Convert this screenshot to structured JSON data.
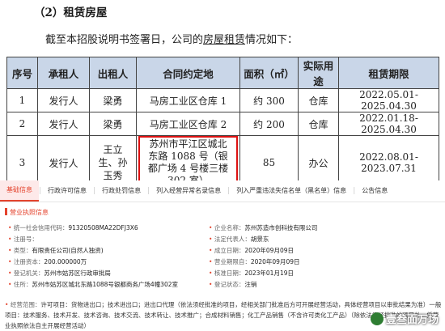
{
  "heading": "（2）租赁房屋",
  "intro": {
    "pre": "截至本招股说明书签署日，公司的",
    "ul": "房屋租赁",
    "post": "情况如下："
  },
  "table": {
    "headers": [
      "序号",
      "承租人",
      "出租人",
      "合同约定地",
      "面积（㎡）",
      "实际用途",
      "租赁期限"
    ],
    "rows": [
      [
        "1",
        "发行人",
        "梁勇",
        "马房工业区仓库 1",
        "约 300",
        "仓库",
        "2022.05.01-2025.04.30"
      ],
      [
        "2",
        "发行人",
        "梁勇",
        "马房工业区仓库 2",
        "约 200",
        "仓库",
        "2022.01.18-2025.04.30"
      ],
      [
        "3",
        "发行人",
        "王立生、孙玉秀",
        "苏州市平江区城北东路 1088 号（银都广场 4 号楼三楼 302 室）",
        "85",
        "办公",
        "2022.08.01-2023.07.31"
      ]
    ]
  },
  "tabs": [
    "基础信息",
    "行政许可信息",
    "行政处罚信息",
    "列入经营异常名录信息",
    "列入严重违法失信名单（黑名单）信息",
    "公告信息"
  ],
  "section_title": "营业执照信息",
  "left_fields": [
    {
      "k": "统一社会信用代码：",
      "v": "91320508MA22DFJ3X6"
    },
    {
      "k": "注册号：",
      "v": ""
    },
    {
      "k": "类型：",
      "v": "有限责任公司(自然人独资)"
    },
    {
      "k": "注册资本：",
      "v": "200.000000万"
    },
    {
      "k": "登记机关：",
      "v": "苏州市姑苏区行政审批局"
    },
    {
      "k": "住所：",
      "v": "苏州市姑苏区城北东路1088号银都商务广场4幢302室"
    }
  ],
  "right_fields": [
    {
      "k": "企业名称：",
      "v": "苏州苏造市创科技有限公司"
    },
    {
      "k": "法定代表人：",
      "v": "胡景东"
    },
    {
      "k": "成立日期：",
      "v": "2020年09月09日"
    },
    {
      "k": "营业期限自：",
      "v": "2020年09月09日"
    },
    {
      "k": "核准日期：",
      "v": "2023年01月19日"
    },
    {
      "k": "登记状态：",
      "v": "注销"
    }
  ],
  "business_scope": {
    "k": "经营范围：",
    "v": "许可项目：货物进出口；技术进出口；进出口代理（依法须经批准的项目，经相关部门批准后方可开展经营活动，具体经营项目以审批结果为准）一般项目：技术服务、技术开发、技术咨询、技术交流、技术转让、技术推广；合成材料销售；化工产品销售（不含许可类化工产品）（除依法须经批准的项目外，凭营业执照依法自主开展经营活动）"
  },
  "watermark": "壹叁面万场"
}
